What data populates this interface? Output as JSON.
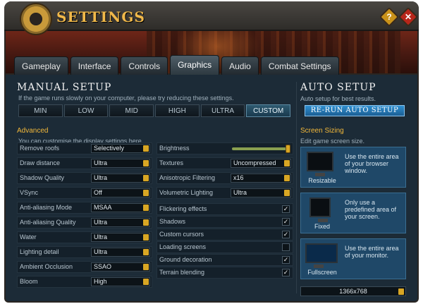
{
  "window": {
    "title": "SETTINGS",
    "help": "?",
    "close": "✕"
  },
  "tabs": [
    {
      "label": "Gameplay",
      "active": false
    },
    {
      "label": "Interface",
      "active": false
    },
    {
      "label": "Controls",
      "active": false
    },
    {
      "label": "Graphics",
      "active": true
    },
    {
      "label": "Audio",
      "active": false
    },
    {
      "label": "Combat Settings",
      "active": false
    }
  ],
  "manual": {
    "title": "MANUAL SETUP",
    "note": "If the game runs slowly on your computer, please try reducing these settings.",
    "presets": [
      "MIN",
      "LOW",
      "MID",
      "HIGH",
      "ULTRA",
      "CUSTOM"
    ],
    "active_preset": "CUSTOM"
  },
  "advanced": {
    "title": "Advanced",
    "note": "You can customise the display settings here.",
    "left": [
      {
        "label": "Remove roofs",
        "value": "Selectively"
      },
      {
        "label": "Draw distance",
        "value": "Ultra"
      },
      {
        "label": "Shadow Quality",
        "value": "Ultra"
      },
      {
        "label": "VSync",
        "value": "Off"
      },
      {
        "label": "Anti-aliasing Mode",
        "value": "MSAA"
      },
      {
        "label": "Anti-aliasing Quality",
        "value": "Ultra"
      },
      {
        "label": "Water",
        "value": "Ultra"
      },
      {
        "label": "Lighting detail",
        "value": "Ultra"
      },
      {
        "label": "Ambient Occlusion",
        "value": "SSAO"
      },
      {
        "label": "Bloom",
        "value": "High"
      }
    ],
    "right_dropdowns": [
      {
        "label": "Textures",
        "value": "Uncompressed"
      },
      {
        "label": "Anisotropic Filtering",
        "value": "x16"
      },
      {
        "label": "Volumetric Lighting",
        "value": "Ultra"
      }
    ],
    "brightness": {
      "label": "Brightness",
      "level": 1.0
    },
    "toggles": [
      {
        "label": "Flickering effects",
        "checked": true
      },
      {
        "label": "Shadows",
        "checked": true
      },
      {
        "label": "Custom cursors",
        "checked": true
      },
      {
        "label": "Loading screens",
        "checked": false
      },
      {
        "label": "Ground decoration",
        "checked": true
      },
      {
        "label": "Terrain blending",
        "checked": true
      }
    ]
  },
  "auto": {
    "title": "AUTO SETUP",
    "note": "Auto setup for best results.",
    "button": "RE-RUN AUTO SETUP"
  },
  "screen": {
    "title": "Screen Sizing",
    "note": "Edit game screen size.",
    "modes": [
      {
        "label": "Resizable",
        "desc": "Use the entire area of your browser window."
      },
      {
        "label": "Fixed",
        "desc": "Only use a predefined area of your screen."
      },
      {
        "label": "Fullscreen",
        "desc": "Use the entire area of your monitor."
      }
    ],
    "resolution": "1366x768"
  },
  "colors": {
    "accent": "#f2b83a",
    "panel": "#1c2b37",
    "active_preset": "#2e5a70"
  }
}
